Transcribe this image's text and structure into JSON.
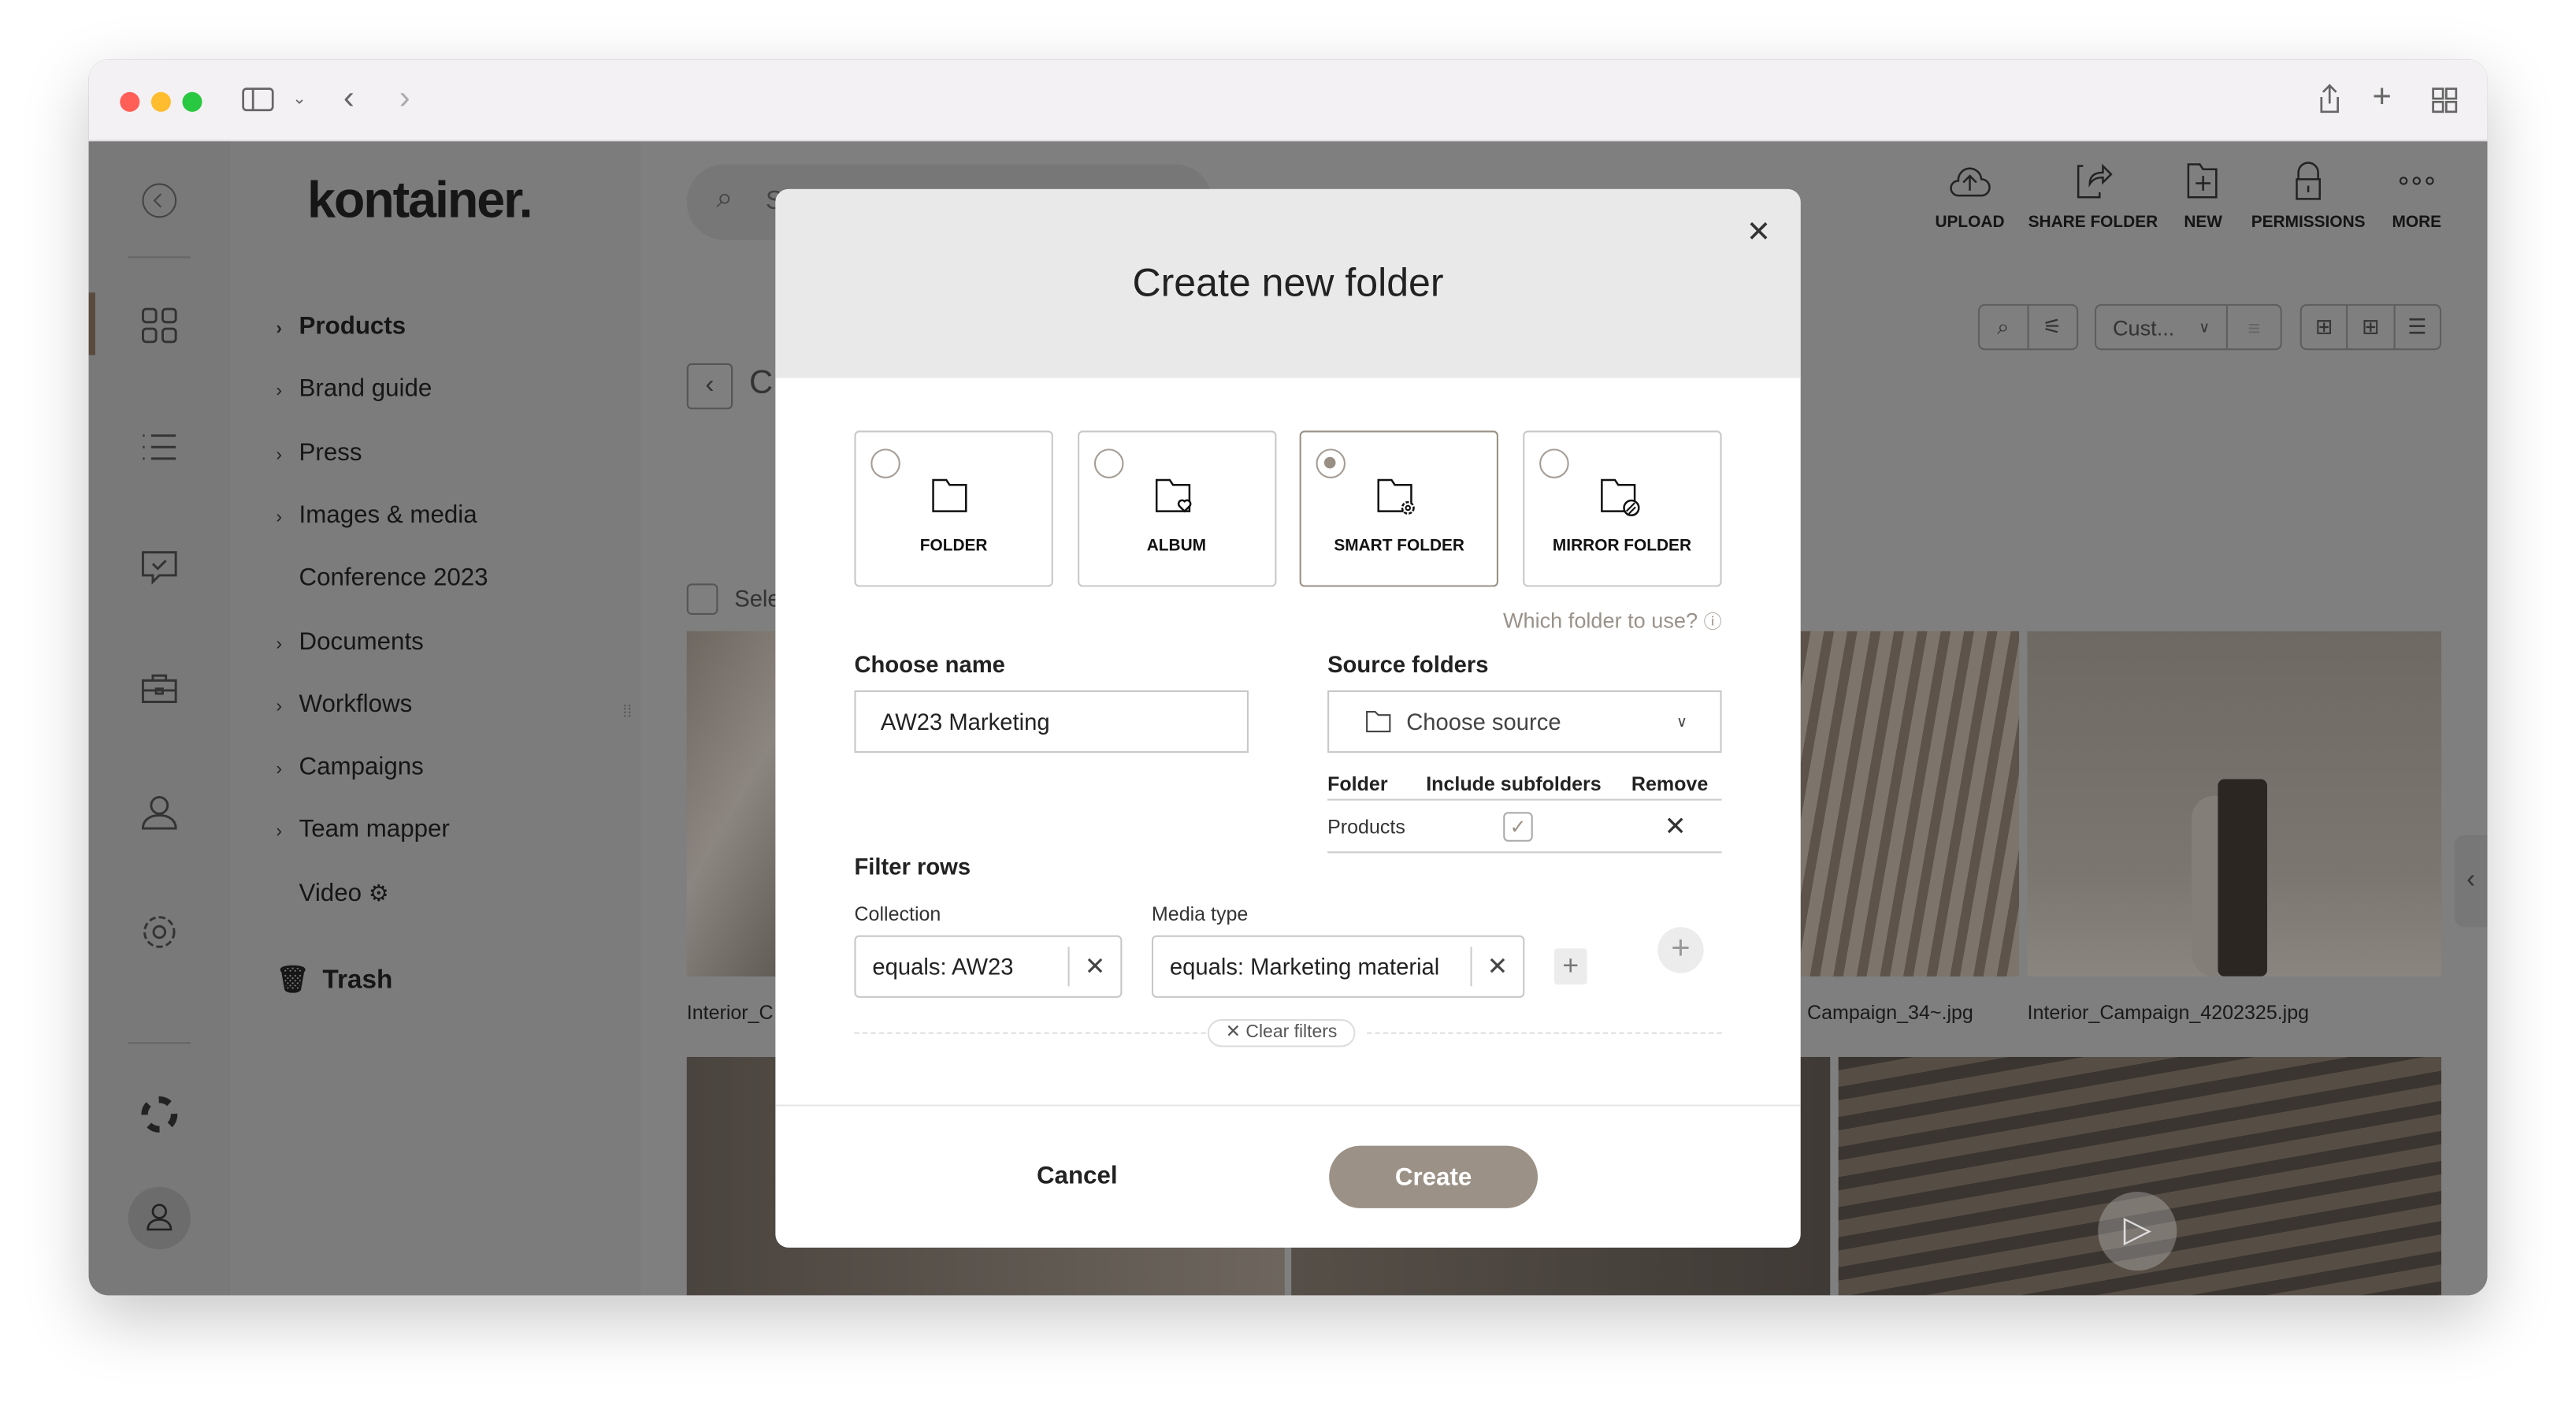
{
  "window": {
    "traffic": [
      "#ff5f57",
      "#febc2e",
      "#28c840"
    ]
  },
  "brand": {
    "logo": "kontainer."
  },
  "sidebar": {
    "items": [
      {
        "label": "Products",
        "chevron": true,
        "bold": true
      },
      {
        "label": "Brand guide",
        "chevron": true
      },
      {
        "label": "Press",
        "chevron": true
      },
      {
        "label": "Images & media",
        "chevron": true
      },
      {
        "label": "Conference 2023",
        "chevron": false
      },
      {
        "label": "Documents",
        "chevron": true
      },
      {
        "label": "Workflows",
        "chevron": true
      },
      {
        "label": "Campaigns",
        "chevron": true
      },
      {
        "label": "Team mapper",
        "chevron": true
      },
      {
        "label": "Video",
        "chevron": false,
        "icon": "gear-icon"
      }
    ],
    "trash": "Trash"
  },
  "toolbar": {
    "upload": "UPLOAD",
    "share": "SHARE FOLDER",
    "new": "NEW",
    "permissions": "PERMISSIONS",
    "more": "MORE",
    "sort": "Cust...",
    "select": "Sele",
    "title_partial": "C",
    "search_partial": "S"
  },
  "gallery": {
    "captions": [
      "Interior_C",
      "Campaign_34~.jpg",
      "Interior_Campaign_4202325.jpg"
    ]
  },
  "modal": {
    "title": "Create new folder",
    "types": [
      {
        "label": "FOLDER",
        "selected": false
      },
      {
        "label": "ALBUM",
        "selected": false
      },
      {
        "label": "SMART FOLDER",
        "selected": true
      },
      {
        "label": "MIRROR FOLDER",
        "selected": false
      }
    ],
    "help": "Which folder to use?",
    "name_label": "Choose name",
    "name_value": "AW23 Marketing",
    "source_label": "Source folders",
    "source_placeholder": "Choose source",
    "table_headers": [
      "Folder",
      "Include subfolders",
      "Remove"
    ],
    "table_rows": [
      {
        "folder": "Products",
        "include_subfolders": true
      }
    ],
    "filter_label": "Filter rows",
    "filters": [
      {
        "label": "Collection",
        "value": "equals: AW23"
      },
      {
        "label": "Media type",
        "value": "equals: Marketing material"
      }
    ],
    "clear": "Clear filters",
    "cancel": "Cancel",
    "create": "Create",
    "accent": "#9c9186"
  }
}
